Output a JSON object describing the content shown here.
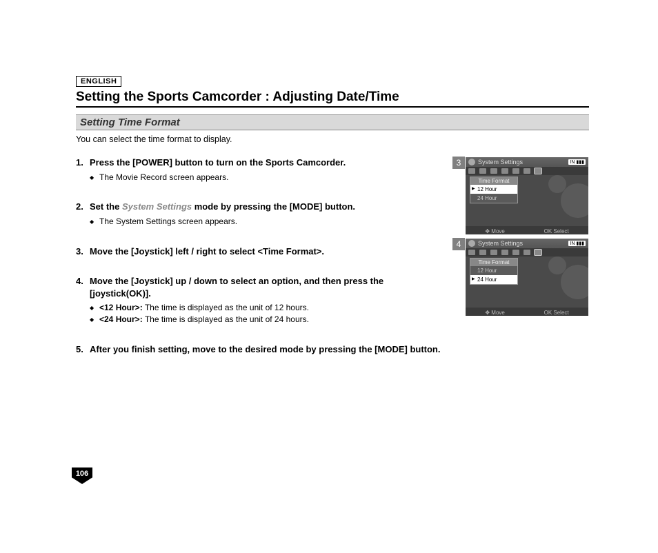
{
  "lang": "ENGLISH",
  "title": "Setting the Sports Camcorder : Adjusting Date/Time",
  "subtitle": "Setting Time Format",
  "intro": "You can select the time format to display.",
  "steps": [
    {
      "text": "Press the [POWER] button to turn on the Sports Camcorder.",
      "subs": [
        {
          "plain": "The Movie Record screen appears."
        }
      ]
    },
    {
      "prefix": "Set the ",
      "gray": "System Settings",
      "suffix": " mode by pressing the [MODE] button.",
      "subs": [
        {
          "plain": "The System Settings screen appears."
        }
      ]
    },
    {
      "text": "Move the [Joystick] left / right to select <Time Format>."
    },
    {
      "text": "Move the [Joystick] up / down to select an option, and then press the [joystick(OK)].",
      "subs": [
        {
          "bold": "<12 Hour>:",
          "plain": " The time is displayed as the unit of 12 hours."
        },
        {
          "bold": "<24 Hour>:",
          "plain": " The time is displayed as the unit of 24 hours."
        }
      ]
    },
    {
      "text": "After you finish setting, move to the desired mode by pressing the [MODE] button."
    }
  ],
  "screens": [
    {
      "num": "3",
      "header": "System Settings",
      "batt": "IN ▮▮▮",
      "menu_title": "Time Format",
      "opts": [
        "12 Hour",
        "24 Hour"
      ],
      "sel": 0,
      "foot_move": "Move",
      "foot_ok": "OK",
      "foot_select": "Select"
    },
    {
      "num": "4",
      "header": "System Settings",
      "batt": "IN ▮▮▮",
      "menu_title": "Time Format",
      "opts": [
        "12 Hour",
        "24 Hour"
      ],
      "sel": 1,
      "foot_move": "Move",
      "foot_ok": "OK",
      "foot_select": "Select"
    }
  ],
  "page_number": "106"
}
